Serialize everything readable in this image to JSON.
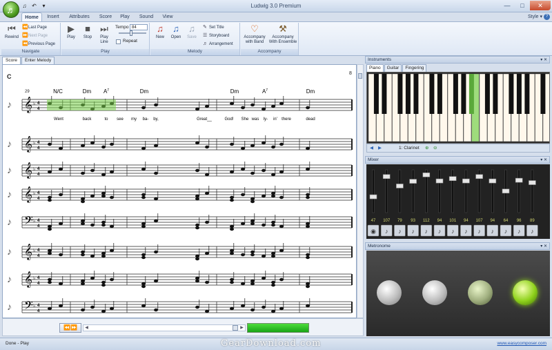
{
  "window": {
    "title": "Ludwig 3.0 Premium",
    "orb_icon": "app-orb-icon"
  },
  "ribbon_tabs": [
    "Home",
    "Insert",
    "Attributes",
    "Score",
    "Play",
    "Sound",
    "View"
  ],
  "active_tab": "Home",
  "style_menu": "Style ▾",
  "navigate": {
    "rewind": "Rewind",
    "last_page": "Last Page",
    "next_page": "Next Page",
    "previous_page": "Previous Page",
    "group_label": "Navigate"
  },
  "play": {
    "play": "Play",
    "stop": "Stop",
    "play_line": "Play Line",
    "tempo_label": "Tempo",
    "tempo_value": "84",
    "repeat": "Repeat",
    "group_label": "Play"
  },
  "melody": {
    "new": "New",
    "open": "Open",
    "save": "Save",
    "set_title": "Set Title",
    "storyboard": "Storyboard",
    "arrangement": "Arrangement",
    "group_label": "Melody"
  },
  "accompany": {
    "with_band": "Accompany with Band",
    "with_ensemble": "Accompany With Ensemble",
    "group_label": "Accompany"
  },
  "score_tabs": [
    "Score",
    "Enter Melody"
  ],
  "score": {
    "key_label": "C",
    "page_number": "8",
    "measure_number": "29",
    "chords": [
      "N/C",
      "Dm",
      "A7",
      "Dm",
      "Dm",
      "A7",
      "Dm"
    ],
    "lyrics": [
      "Went",
      "back",
      "to",
      "see",
      "my",
      "ba-",
      "by,",
      "Great__",
      "God!",
      "She",
      "was",
      "ly-",
      "in'",
      "there",
      "dead"
    ],
    "staff_instruments": [
      "violin-icon",
      "saxophone-icon",
      "clarinet-icon",
      "trumpet-icon",
      "trombone-icon",
      "saxophone-icon",
      "saxophone-icon",
      "saxophone-icon"
    ]
  },
  "instruments_panel": {
    "title": "Instruments",
    "tabs": [
      "Piano",
      "Guitar",
      "Fingering"
    ],
    "active_tab": "Piano",
    "instrument_label": "1: Clarinet"
  },
  "mixer": {
    "title": "Mixer",
    "levels": [
      47,
      107,
      79,
      93,
      112,
      94,
      101,
      94,
      107,
      94,
      64,
      96,
      89
    ]
  },
  "metronome": {
    "title": "Metronome"
  },
  "status": {
    "text": "Done - Play",
    "link": "www.easycomposer.com"
  },
  "watermark": "GearDownload.com",
  "colors": {
    "accent_green": "#24b51e",
    "ribbon_blue": "#dfe8f5"
  }
}
